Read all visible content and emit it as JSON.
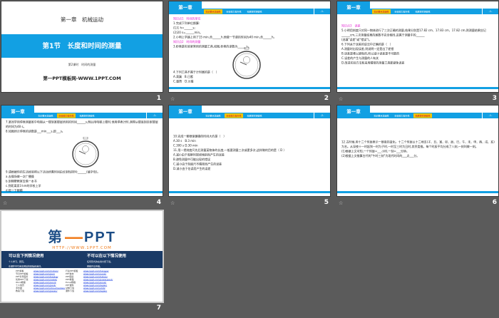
{
  "slides": [
    {
      "number": "1",
      "chapter": "第一章　机械运动",
      "section": "第1节　长度和时间的测量",
      "subtitle": "第2课时　时间的测量",
      "site": "第一PPT模板网-WWW.1PPT.COM"
    },
    {
      "number": "2",
      "chapter": "第一章",
      "page": "-1-",
      "active_tab": 0,
      "lines": [
        {
          "t": "知识点1　时间的单位",
          "k": true
        },
        {
          "t": "1.完成下列单位换算:"
        },
        {
          "t": "(1)1 h=______s;"
        },
        {
          "t": "(2)20 s=______min。"
        },
        {
          "t": "2.小明上学路上用了15 min,合______h,他做一节课的时间为40 min,合______h。"
        },
        {
          "t": "知识点2　时间的测量",
          "k": true
        },
        {
          "t": "3.秒表是实验室常用的测量工具,如图,秒表的读数为______s。"
        }
      ],
      "lines2": [
        {
          "t": "4.下列工具不属于计时器的是（　）"
        },
        {
          "t": "A.滴漏　B.日晷"
        },
        {
          "t": "C.量筒　D.沙漏"
        }
      ]
    },
    {
      "number": "3",
      "chapter": "第一章",
      "page": "-1-",
      "active_tab": 0,
      "lines": [
        {
          "t": "知识点3　误差",
          "k": true
        },
        {
          "t": "5.小明用刻度尺对同一物体进行了三次正确的测量,结果分别是17.82 cm、17.83 cm、17.82 cm,则测量结果应记______cm,三次测量结果的尾数不完全相同,这属于测量中的______"
        },
        {
          "t": "(选填\"误差\"或\"错误\")。"
        },
        {
          "t": "6.下列关于误差的说法中正确的是（　）"
        },
        {
          "t": "A.测量时出现误差,则说明一定是出了差错"
        },
        {
          "t": "B.误差是难以避免的,所以减小误差是不可能的"
        },
        {
          "t": "C.误差的产生与测量的人有关"
        },
        {
          "t": "D.改进实验方法和采用精密的测量工具能避免误差"
        }
      ]
    },
    {
      "number": "4",
      "chapter": "第一章",
      "page": "-1-",
      "active_tab": 1,
      "lines": [
        {
          "t": "7.某同学用停表测量家中电梯从一楼到某楼层所用的时间______s,然后用电梯上楼时,他用停表计时,测得从楼底到自家楼层的时间为48 s。"
        },
        {
          "t": "8.如图所示停表的读数是___min___s,即___s。"
        }
      ],
      "lines2": [
        {
          "t": "9.请根据你的生活经验将以下活动所需时间由长到短排列:______(填字母)。"
        },
        {
          "t": "a.去操场做一次广播操"
        },
        {
          "t": "b.到隔壁教室去借一本书"
        },
        {
          "t": "c.到距离家3 km的学校上学"
        },
        {
          "t": "d.眨一下眼睛"
        }
      ]
    },
    {
      "number": "5",
      "chapter": "第一章",
      "page": "-2-",
      "active_tab": 1,
      "lines": [
        {
          "t": "10.完成一套眼保健操的时间大约是（　）"
        },
        {
          "t": "A.30 s　B.3 min"
        },
        {
          "t": "C.300 s D.30 min"
        },
        {
          "t": "11.用一把刻度尺先后测量某物体的长度,一般要测量三次或更多次,这样做的目的是（ D ）"
        },
        {
          "t": "A.减小由于观察时视线倾斜而产生的误差"
        },
        {
          "t": "B.避免测量中可能出现的错误"
        },
        {
          "t": "C.减小由于刻度尺不精密而产生的误差"
        },
        {
          "t": "D.减小由于估读而产生的误差"
        }
      ]
    },
    {
      "number": "6",
      "chapter": "第一章",
      "page": "-1-",
      "active_tab": 2,
      "lines": [
        {
          "t": "12.古时候,用十二个时辰表示一昼夜的变化。十二个时辰以十二地支(子、丑、寅、卯、辰、巳、午、未、申、酉、戌、亥)为名。从深夜十一时起到一时为子时,一时至三时为丑时,其余类推。每个时辰平均分成了八刻,一刻叫做一刻。"
        },
        {
          "t": "(1)根据上文可知,一个时辰=___小时,一刻=___分钟。"
        },
        {
          "t": "(2)根据上文推算古代的\"午时三刻\"为现代时间的___点___分。"
        }
      ]
    },
    {
      "number": "7",
      "logo": "第一PPT",
      "url": "HTTP://WWW.1PPT.COM",
      "can_title": "可以在下列情况使用",
      "can_items": [
        "个人学习、研究。",
        "在课件中引用本网站的模板和素材。"
      ],
      "cannot_title": "不可以在以下情况使用",
      "cannot_items": [
        "任何形式的在线付费下载。",
        "网络共享传播。"
      ],
      "links_left": [
        [
          "PPT模板",
          "www.1ppt.com/moban/"
        ],
        [
          "节日PPT模板",
          "www.1ppt.com/jieri/"
        ],
        [
          "PPT背景图片",
          "www.1ppt.com/beijing/"
        ],
        [
          "优秀PPT下载",
          "www.1ppt.com/xiazai/"
        ],
        [
          "Word教程",
          "www.1ppt.com/word/"
        ],
        [
          "个人简历",
          "www.1ppt.com/jianli/"
        ],
        [
          "手抄报",
          "www.1ppt.com/shouchaobao/"
        ],
        [
          "教案下载",
          "www.1ppt.com/jiaoan/"
        ]
      ],
      "links_right": [
        [
          "行业PPT模板",
          "www.1ppt.com/hangye/"
        ],
        [
          "PPT素材",
          "www.1ppt.com/sucai/"
        ],
        [
          "PPT图表",
          "www.1ppt.com/tubiao/"
        ],
        [
          "PPT教程",
          "www.1ppt.com/powerpoint/"
        ],
        [
          "Excel教程",
          "www.1ppt.com/excel/"
        ],
        [
          "PPT课件",
          "www.1ppt.com/kejian/"
        ],
        [
          "试卷下载",
          "www.1ppt.com/shiti/"
        ],
        [
          "课件下载",
          "www.1ppt.com/kejian/"
        ]
      ]
    }
  ],
  "tabs": [
    "知识要点基础练",
    "综合能力提升练",
    "拓展探究突破练"
  ],
  "animation_icon": "play-animation-icon",
  "colors": {
    "accent": "#12a0e3",
    "highlight": "#f5c400",
    "answer": "#e020d0",
    "navy": "#1a3a66",
    "orange": "#f07a18"
  }
}
